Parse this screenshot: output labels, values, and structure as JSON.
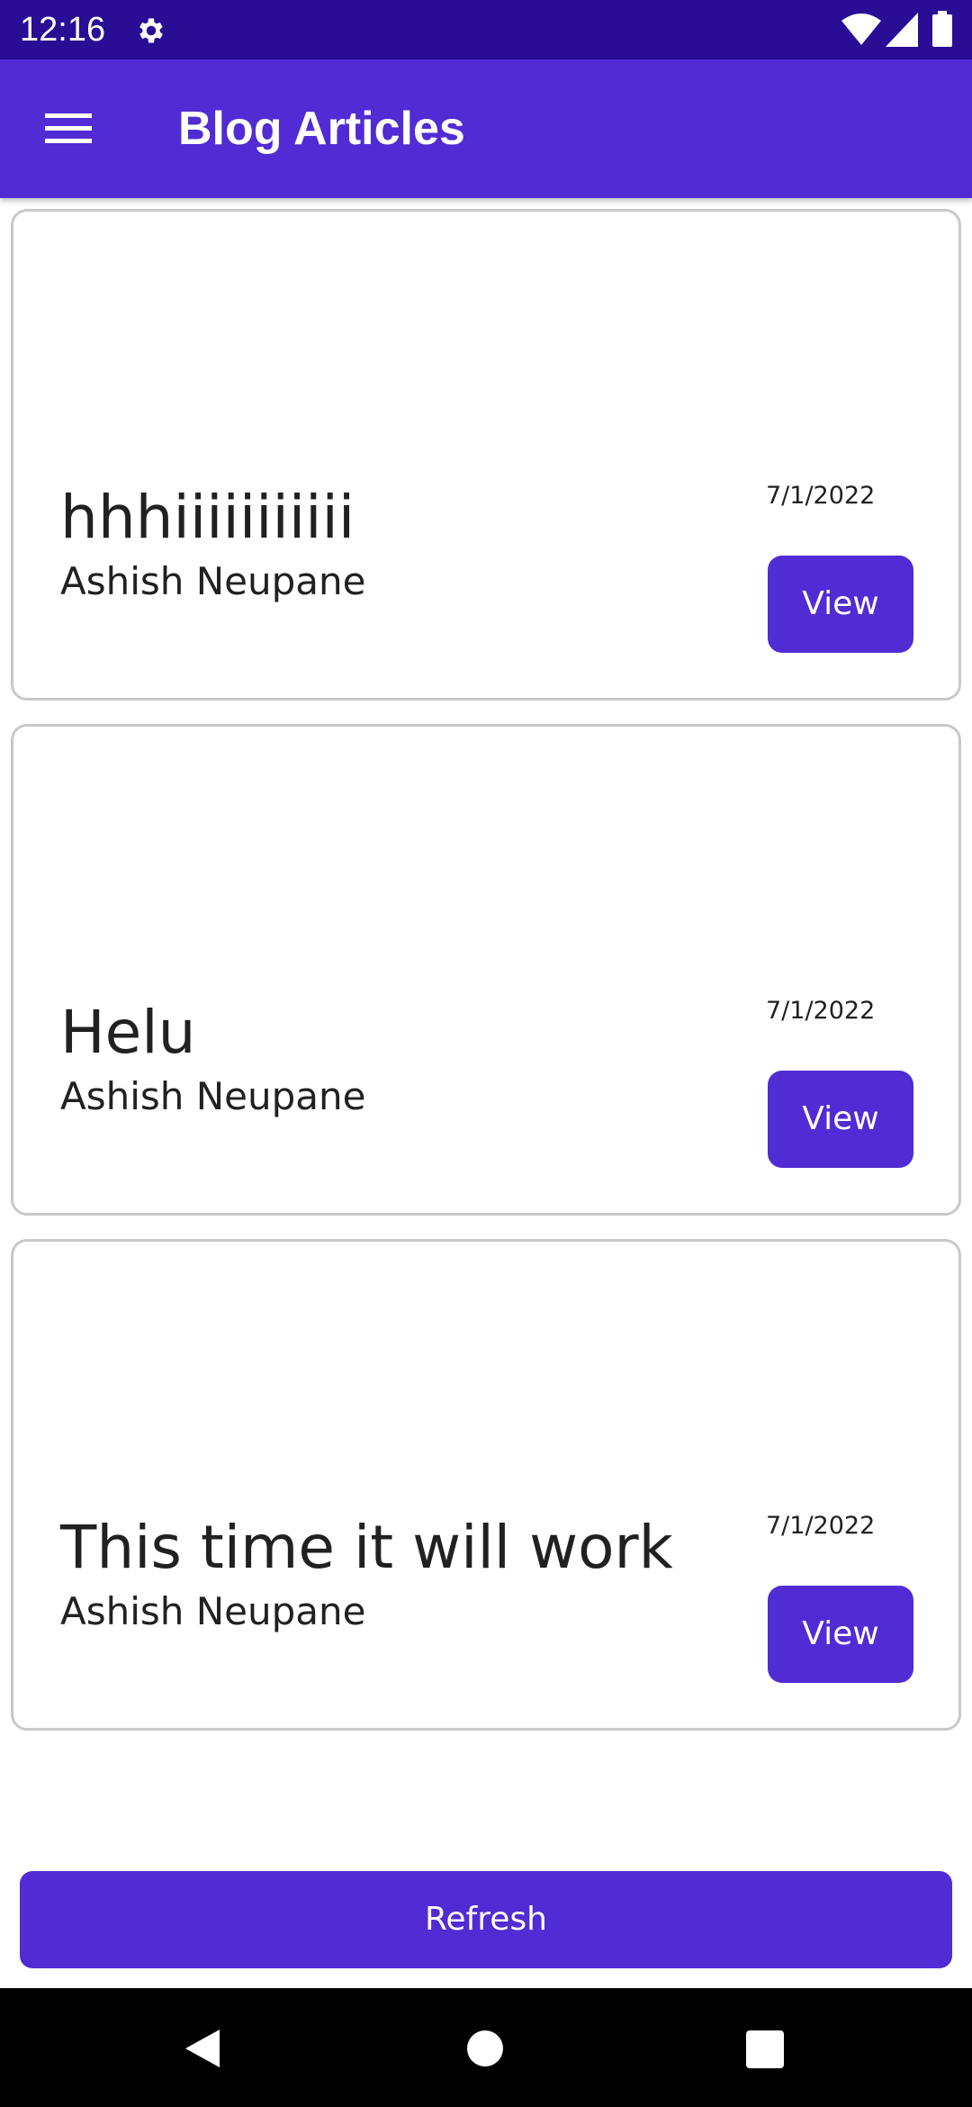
{
  "status_bar": {
    "time": "12:16",
    "icons": [
      "gear-icon",
      "wifi-icon",
      "signal-icon",
      "battery-icon"
    ]
  },
  "app_bar": {
    "title": "Blog Articles",
    "menu_icon": "hamburger-menu-icon",
    "background": "#512bd4"
  },
  "articles": [
    {
      "title": "hhhiiiiiiiiiii",
      "author": "Ashish Neupane",
      "date": "7/1/2022",
      "button_label": "View"
    },
    {
      "title": "Helu",
      "author": "Ashish Neupane",
      "date": "7/1/2022",
      "button_label": "View"
    },
    {
      "title": "This time it will work",
      "author": "Ashish Neupane",
      "date": "7/1/2022",
      "button_label": "View"
    }
  ],
  "refresh": {
    "label": "Refresh"
  },
  "nav_bar": {
    "icons": [
      "back-icon",
      "home-icon",
      "recents-icon"
    ]
  },
  "colors": {
    "accent": "#512bd4",
    "status_bar": "#2a0d95",
    "card_border": "#c9c9c9"
  }
}
